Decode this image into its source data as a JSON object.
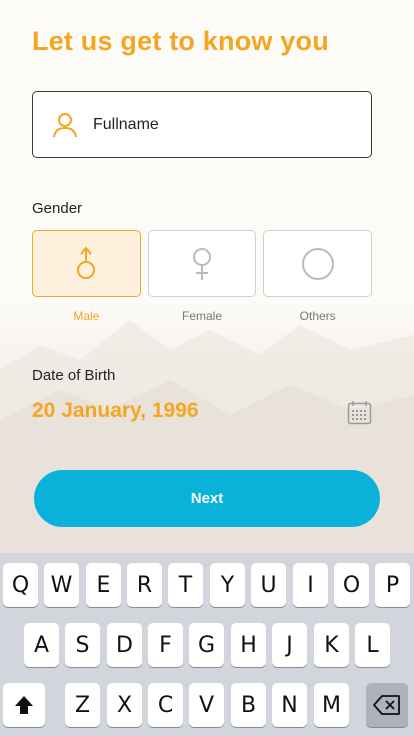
{
  "header": {
    "title": "Let us get to know you"
  },
  "fullname": {
    "placeholder": "Fullname",
    "icon": "person-icon"
  },
  "gender": {
    "label": "Gender",
    "options": [
      {
        "label": "Male",
        "icon": "male-symbol-icon",
        "selected": true
      },
      {
        "label": "Female",
        "icon": "female-symbol-icon",
        "selected": false
      },
      {
        "label": "Others",
        "icon": "circle-icon",
        "selected": false
      }
    ]
  },
  "dob": {
    "label": "Date of Birth",
    "value": "20 January, 1996",
    "icon": "calendar-icon"
  },
  "next_button": {
    "label": "Next"
  },
  "colors": {
    "accent": "#f4a623",
    "button": "#0ab1d9",
    "selected_bg": "#fdf0dd"
  },
  "keyboard": {
    "row1": [
      "Q",
      "W",
      "E",
      "R",
      "T",
      "Y",
      "U",
      "I",
      "O",
      "P"
    ],
    "row2": [
      "A",
      "S",
      "D",
      "F",
      "G",
      "H",
      "J",
      "K",
      "L"
    ],
    "row3": [
      "Z",
      "X",
      "C",
      "V",
      "B",
      "N",
      "M"
    ],
    "shift_icon": "shift-icon",
    "backspace_icon": "backspace-icon"
  }
}
